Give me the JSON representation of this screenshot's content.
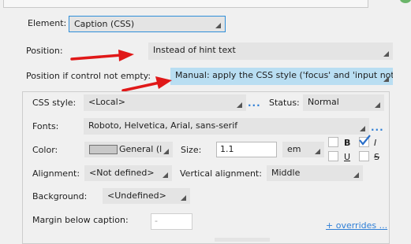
{
  "element": {
    "label": "Element:",
    "value": "Caption (CSS)"
  },
  "position": {
    "label": "Position:",
    "value": "Instead of hint text"
  },
  "position_not_empty": {
    "label": "Position if control not empty:",
    "value": "Manual: apply the CSS style ('focus' and 'input not"
  },
  "css_style": {
    "label": "CSS style:",
    "value": "<Local>",
    "more": "..."
  },
  "status": {
    "label": "Status:",
    "value": "Normal"
  },
  "fonts": {
    "label": "Fonts:",
    "value": "Roboto, Helvetica, Arial, sans-serif",
    "more": "..."
  },
  "color": {
    "label": "Color:",
    "value": "General (l",
    "swatch": "#c8c8c8"
  },
  "size": {
    "label": "Size:",
    "value": "1.1",
    "unit": "em"
  },
  "text_style": {
    "bold": {
      "label": "B",
      "checked": false
    },
    "italic": {
      "label": "I",
      "checked": true
    },
    "underline": {
      "label": "U",
      "checked": false
    },
    "strike": {
      "label": "S",
      "checked": false
    }
  },
  "alignment": {
    "label": "Alignment:",
    "value": "<Not defined>"
  },
  "vertical_alignment": {
    "label": "Vertical alignment:",
    "value": "Middle"
  },
  "background": {
    "label": "Background:",
    "value": "<Undefined>"
  },
  "margin_below": {
    "label": "Margin below caption:",
    "value": "-"
  },
  "overrides_link": "+ overrides ...",
  "colors": {
    "accent_link": "#2f7fd6",
    "highlight": "#b9def2",
    "arrow": "#e01818",
    "check": "#2a6fc9"
  }
}
